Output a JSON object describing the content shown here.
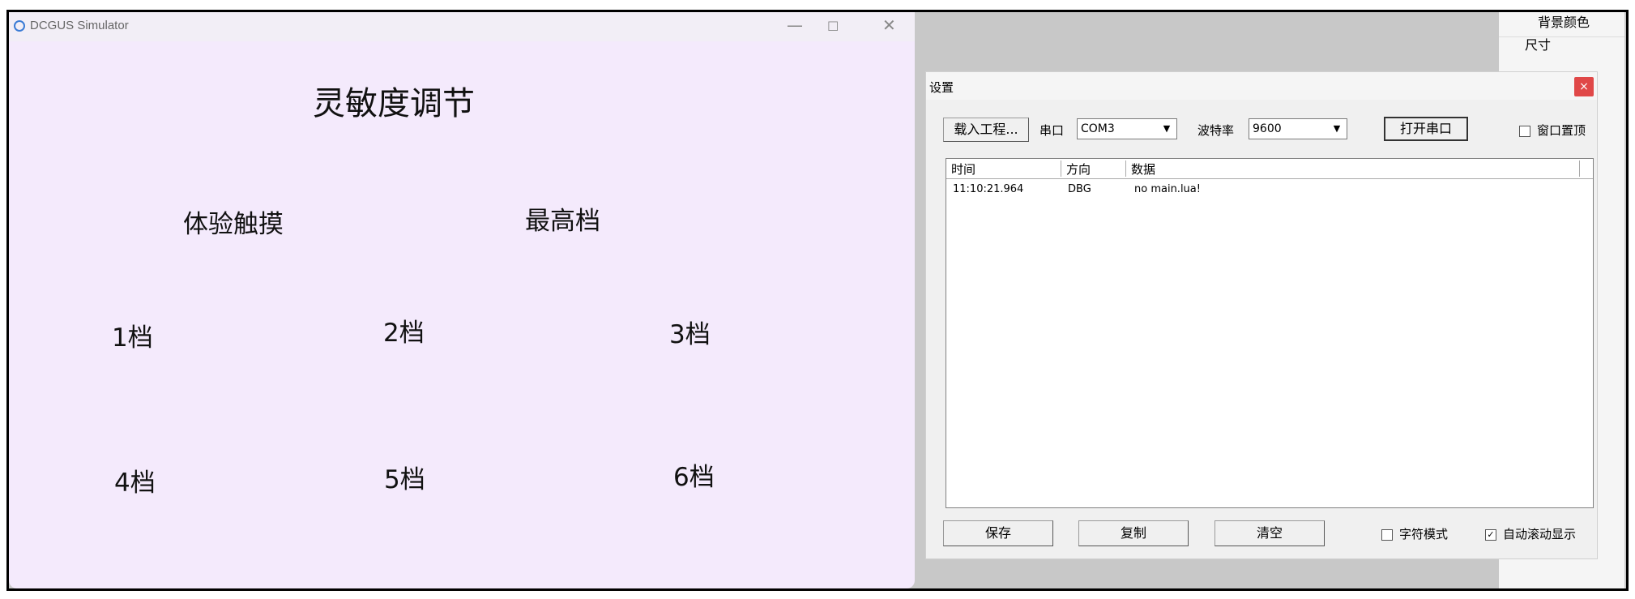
{
  "simulator": {
    "title": "DCGUS Simulator",
    "controls": {
      "minimize": "—",
      "maximize": "☐",
      "close": "✕"
    },
    "heading": "灵敏度调节",
    "options": {
      "trial_touch": "体验触摸",
      "highest": "最高档",
      "level1": "1档",
      "level2": "2档",
      "level3": "3档",
      "level4": "4档",
      "level5": "5档",
      "level6": "6档"
    }
  },
  "settings": {
    "title": "设置",
    "close": "×",
    "load_project": "载入工程...",
    "port_label": "串口",
    "port_value": "COM3",
    "baud_label": "波特率",
    "baud_value": "9600",
    "open_port": "打开串口",
    "window_top": "窗口置顶",
    "columns": [
      "时间",
      "方向",
      "数据"
    ],
    "rows": [
      {
        "time": "11:10:21.964",
        "dir": "DBG",
        "data": "no main.lua!"
      }
    ],
    "save": "保存",
    "copy": "复制",
    "clear": "清空",
    "char_mode": "字符模式",
    "auto_scroll": "自动滚动显示",
    "auto_scroll_checked": "✓"
  },
  "properties": {
    "bg_color": "背景颜色",
    "size": "尺寸"
  }
}
